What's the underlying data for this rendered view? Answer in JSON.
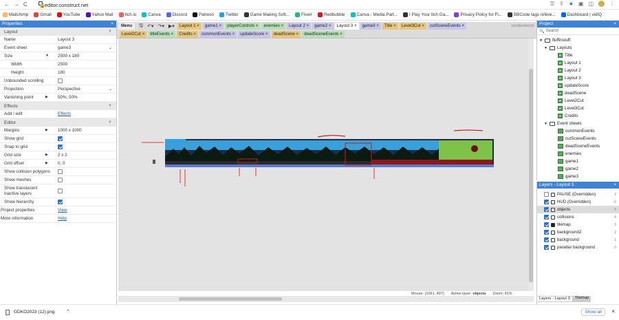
{
  "browser": {
    "url": "editor.construct.net",
    "back": "←",
    "fwd": "→",
    "reload": "C",
    "icons": [
      "key-icon",
      "share-icon",
      "star-icon",
      "ext-icon",
      "menu-icon"
    ]
  },
  "bookmarks": [
    "Mailchimp",
    "Gmail",
    "YouTube",
    "Yahoo Mail",
    "Itch.io",
    "Canva",
    "Discord",
    "Patreon",
    "Twitter",
    "Game Making Soft...",
    "Fiverr",
    "Redbubble",
    "Canva - Media Part...",
    "I Play Your Itch Ga...",
    "Privacy Policy for Fl...",
    "BBCode tags refere...",
    "Dashboard | vidIQ"
  ],
  "properties": {
    "title": "Properties",
    "close": "×",
    "section_layout": "Layout",
    "rows": [
      {
        "k": "Name",
        "v": "Layout 3"
      },
      {
        "k": "Event sheet",
        "v": "game3"
      },
      {
        "k": "Size",
        "v": "2500 x 180"
      },
      {
        "k": "Width",
        "v": "2500"
      },
      {
        "k": "Height",
        "v": "180"
      },
      {
        "k": "Unbounded scrolling",
        "v": ""
      },
      {
        "k": "Projection",
        "v": "Perspective"
      },
      {
        "k": "Vanishing point",
        "v": "50%, 50%"
      }
    ],
    "section_effects": "Effects",
    "effects_row": {
      "k": "Add / edit",
      "v": "Effects"
    },
    "section_editor": "Editor",
    "editor_rows": [
      {
        "k": "Margins",
        "v": "1000 x 1000"
      },
      {
        "k": "Show grid",
        "v": ""
      },
      {
        "k": "Snap to grid",
        "v": ""
      },
      {
        "k": "Grid size",
        "v": "2 x 2"
      },
      {
        "k": "Grid offset",
        "v": "0, 0"
      },
      {
        "k": "Show collision polygons",
        "v": ""
      },
      {
        "k": "Show meshes",
        "v": ""
      },
      {
        "k": "Show translucent inactive layers",
        "v": ""
      },
      {
        "k": "Show hierarchy",
        "v": ""
      }
    ],
    "project_props": {
      "k": "Project properties",
      "v": "View"
    },
    "more_info": {
      "k": "More information",
      "v": "Help"
    }
  },
  "tabs_row1": [
    "Layout 1",
    "game1",
    "playerControls",
    "enemies",
    "Layout 2",
    "game2",
    "Layout 3",
    "game3",
    "Title",
    "Level3Cut",
    "cutSceneEvents"
  ],
  "tabs_row2": [
    "Level2Cut",
    "titleEvents",
    "Credits",
    "commonEvents",
    "updateScore",
    "deadScene",
    "deadSceneEvents"
  ],
  "toolbar": {
    "menu": "Menu",
    "user": "sanderwood"
  },
  "status": {
    "mouse": "Mouse: (1661, 497)",
    "active_label": "Active layer:",
    "active_value": "objects",
    "zoom": "Zoom: 41%"
  },
  "project": {
    "title": "Project",
    "search_placeholder": "Search",
    "root": "fluffinstuff",
    "layouts_label": "Layouts",
    "layouts": [
      "Title",
      "Layout 1",
      "Layout 2",
      "Layout 3",
      "updateScore",
      "deadScene",
      "Level2Cut",
      "Level3Cut",
      "Credits"
    ],
    "events_label": "Event sheets",
    "events": [
      "commonEvents",
      "cutSceneEvents",
      "deadSceneEvents",
      "enemies",
      "game1",
      "game2",
      "game3"
    ]
  },
  "layers": {
    "title": "Layers - Layout 3",
    "close": "×",
    "items": [
      {
        "name": "PAUSE (Overridden)",
        "num": "7",
        "vis": false
      },
      {
        "name": "HUD (Overridden)",
        "num": "6",
        "vis": true
      },
      {
        "name": "objects",
        "num": "5",
        "vis": true,
        "sel": true
      },
      {
        "name": "collisions",
        "num": "4",
        "vis": true
      },
      {
        "name": "tilemap",
        "num": "3",
        "vis": true
      },
      {
        "name": "background2",
        "num": "2",
        "vis": true
      },
      {
        "name": "background",
        "num": "1",
        "vis": true
      },
      {
        "name": "parallax background",
        "num": "0",
        "vis": true
      }
    ],
    "tab_a": "Layers - Layout 3",
    "tab_b": "Tilemap"
  },
  "downloads": {
    "file": "GDKO2023 (12).png",
    "show_all": "Show all"
  }
}
